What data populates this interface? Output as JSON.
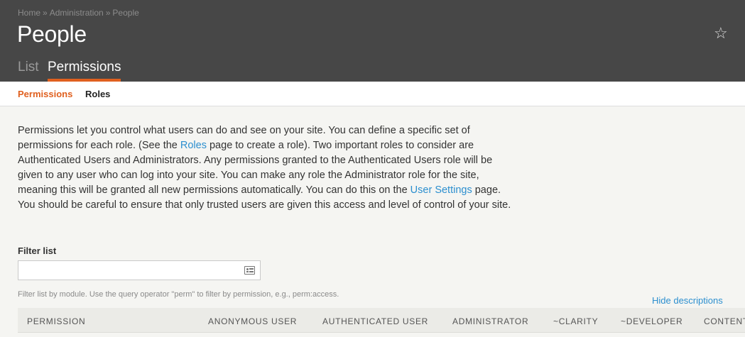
{
  "breadcrumb": {
    "home": "Home",
    "sep": "»",
    "admin": "Administration",
    "current": "People"
  },
  "header": {
    "title": "People",
    "star_icon": "☆"
  },
  "tabs": {
    "list": "List",
    "permissions": "Permissions",
    "active_color": "#e0601f"
  },
  "subtabs": {
    "permissions": "Permissions",
    "roles": "Roles"
  },
  "description": {
    "p1": "Permissions let you control what users can do and see on your site. You can define a specific set of permissions for each role. (See the ",
    "roles_link": "Roles",
    "p2": " page to create a role). Two important roles to consider are Authenticated Users and Administrators. Any permissions granted to the Authenticated Users role will be given to any user who can log into your site. You can make any role the Administrator role for the site, meaning this will be granted all new permissions automatically. You can do this on the ",
    "settings_link": "User Settings",
    "p3": " page. You should be careful to ensure that only trusted users are given this access and level of control of your site."
  },
  "filter": {
    "label": "Filter list",
    "value": "",
    "help": "Filter list by module. Use the query operator \"perm\" to filter by permission, e.g., perm:access."
  },
  "hide_descriptions": "Hide descriptions",
  "table": {
    "headers": [
      "PERMISSION",
      "ANONYMOUS USER",
      "AUTHENTICATED USER",
      "ADMINISTRATOR",
      "~CLARITY",
      "~DEVELOPER",
      "CONTENT"
    ]
  },
  "colors": {
    "header_bg": "#474747",
    "accent": "#e0601f",
    "link": "#2c8fcf",
    "page_bg": "#f5f5f2"
  }
}
